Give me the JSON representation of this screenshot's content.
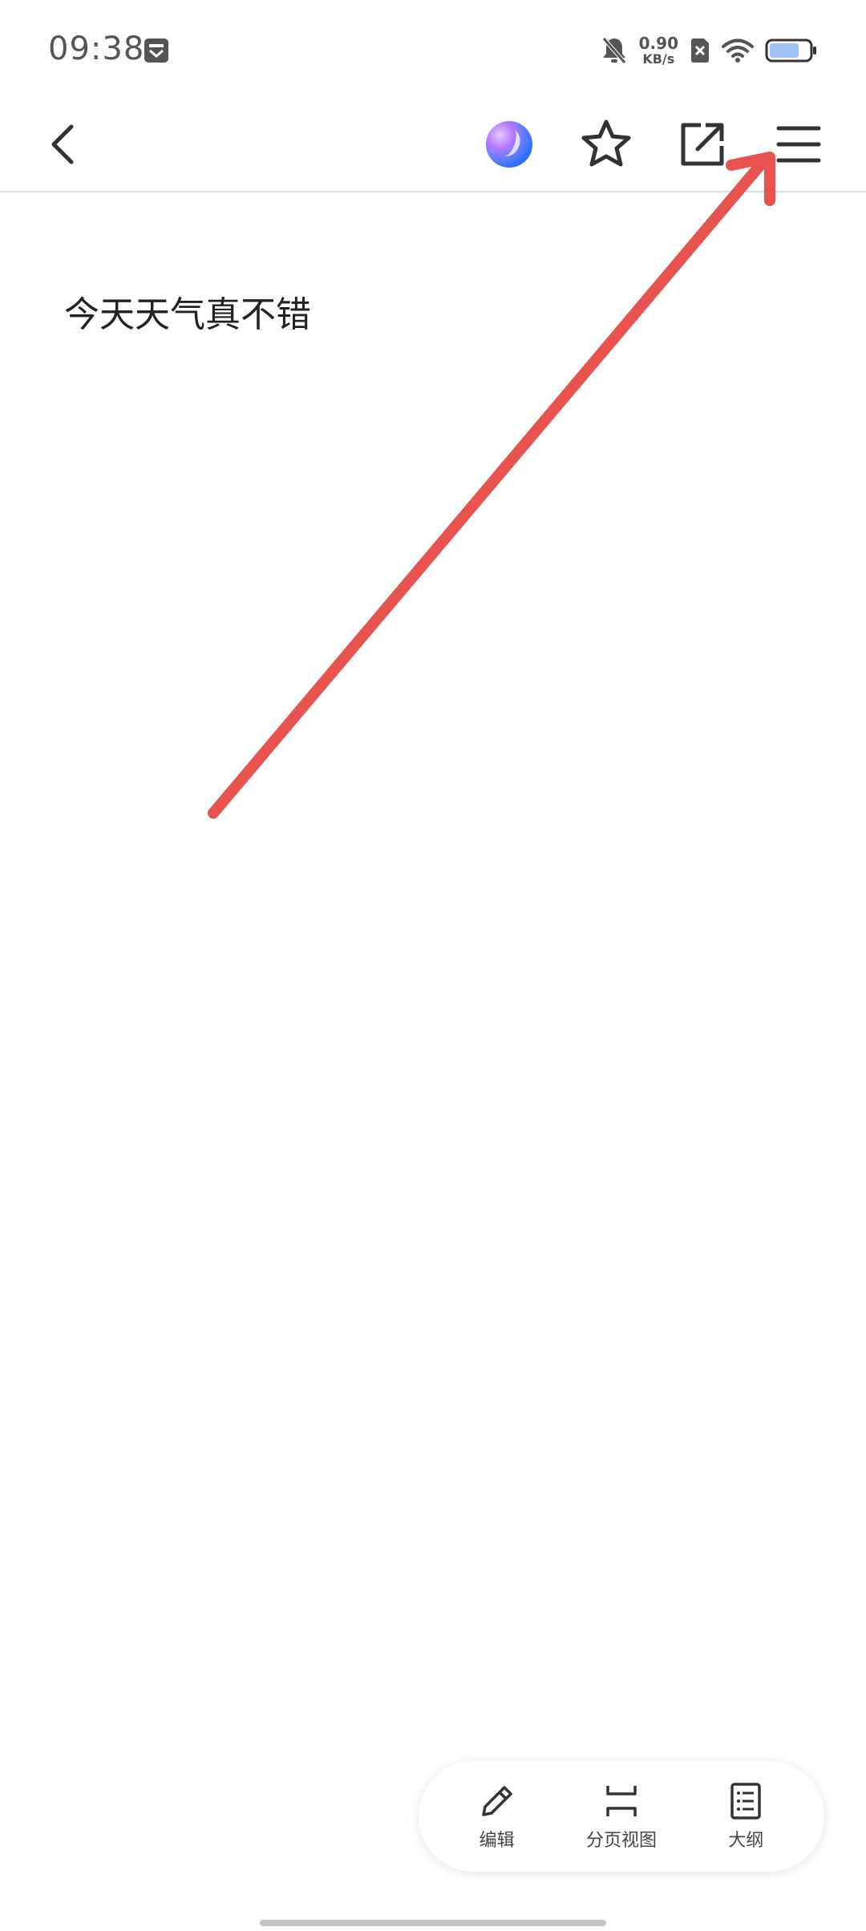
{
  "status_bar": {
    "time": "09:38",
    "net_speed_value": "0.90",
    "net_speed_unit": "KB/s",
    "icons": [
      "notification-app-icon",
      "bell-off-icon",
      "sim-disabled-icon",
      "wifi-icon",
      "battery-icon"
    ]
  },
  "toolbar": {
    "icons": [
      "back-icon",
      "ai-assistant-icon",
      "star-icon",
      "share-icon",
      "menu-icon"
    ]
  },
  "document": {
    "text": "今天天气真不错"
  },
  "annotation": {
    "type": "arrow",
    "color": "#e8524f"
  },
  "bottom_bar": {
    "edit_label": "编辑",
    "page_view_label": "分页视图",
    "outline_label": "大纲"
  }
}
